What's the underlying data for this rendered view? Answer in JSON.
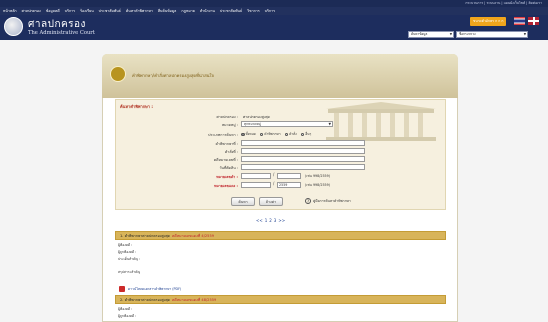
{
  "header": {
    "utility_text": "กระบวนการ | ระบบงาน | แผนผังเว็บไซต์ | ติดต่อเรา",
    "nav_items": [
      "หน้าหลัก",
      "ศาลปกครอง",
      "ข้อมูลคดี",
      "บริการ",
      "ร้องเรียน",
      "ประชาสัมพันธ์",
      "ค้นหาคำพิพากษา",
      "สืบค้นข้อมูล",
      "กฎหมาย",
      "สำนักงาน",
      "ประชาสัมพันธ์",
      "วิชาการ",
      "บริการ"
    ],
    "logo_thai": "ศาลปกครอง",
    "logo_english": "The Administrative Court",
    "lang_badge": "ขนาดตัวอักษร  ก  ก  ก",
    "search_select_1": "ค้นหาข้อมูล",
    "search_select_2": "ชื่อกระทรวง"
  },
  "panel": {
    "title": "คำพิพากษา/คำสั่งศาลปกครองสูงสุดที่น่าสนใจ"
  },
  "form": {
    "heading": "ค้นหาคำพิพากษา :",
    "fields": [
      {
        "label": "ศาลปกครอง :",
        "value": "ศาลปกครองสูงสุด"
      },
      {
        "label": "หมวดหมู่ :",
        "value": "ทุกหมวดหมู่"
      },
      {
        "label": "ประเภทการค้นหา :"
      },
      {
        "label": "คำพิพากษาที่ :"
      },
      {
        "label": "คำสั่งที่ :"
      },
      {
        "label": "คดีหมายเลขที่ :"
      },
      {
        "label": "วันที่ตัดสิน :"
      },
      {
        "label": "หมายเลขดำ :"
      },
      {
        "label": "หมายเลขแดง :"
      }
    ],
    "radios": [
      "ทั้งหมด",
      "คำพิพากษา",
      "คำสั่ง",
      "อื่นๆ"
    ],
    "black_year": "",
    "red_year": "2559",
    "black_hint": "(เช่น 998/2559)",
    "red_hint": "(เช่น 998/2559)",
    "search_button": "ค้นหา",
    "clear_button": "ล้างค่า",
    "help_text": "คู่มือการค้นหาคำพิพากษา"
  },
  "pagination": {
    "prev": "<<",
    "pages": [
      "1",
      "2",
      "3"
    ],
    "next": ">>"
  },
  "results": [
    {
      "title": "1. คำพิพากษาศาลปกครองสูงสุด",
      "case": "คดีหมายเลขแดงที่ 4/2559",
      "lines": [
        "ผู้ฟ้องคดี : ",
        "ผู้ถูกฟ้องคดี : ",
        "ประเด็นสำคัญ : ",
        "สรุปสาระสำคัญ"
      ]
    },
    {
      "title": "2. คำพิพากษาศาลปกครองสูงสุด",
      "case": "คดีหมายเลขแดงที่ 48/2559",
      "lines": [
        "ผู้ฟ้องคดี : ",
        "ผู้ถูกฟ้องคดี : "
      ]
    }
  ],
  "pdf_link": "ดาวน์โหลดเอกสารคำพิพากษา (PDF)"
}
